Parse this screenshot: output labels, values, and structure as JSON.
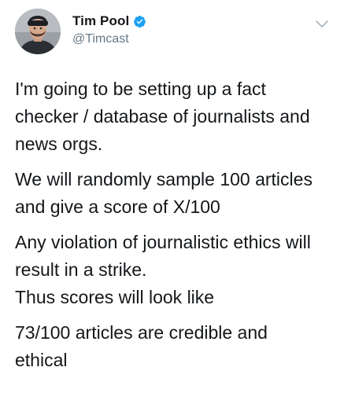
{
  "author": {
    "display_name": "Tim Pool",
    "handle": "@Timcast",
    "verified": true,
    "avatar_icon": "user-avatar",
    "verified_color": "#1da1f2"
  },
  "menu": {
    "icon": "chevron-down-icon"
  },
  "tweet": {
    "paragraphs": [
      "I'm going to be setting up a fact\nchecker / database of journalists and\nnews orgs.",
      "We will randomly sample 100 articles\nand give a score of X/100",
      "Any violation of journalistic ethics will\nresult in a strike.",
      "Thus scores will look like",
      "73/100 articles are credible and\nethical"
    ]
  },
  "colors": {
    "text": "#14171a",
    "secondary": "#657786",
    "accent": "#1da1f2"
  }
}
